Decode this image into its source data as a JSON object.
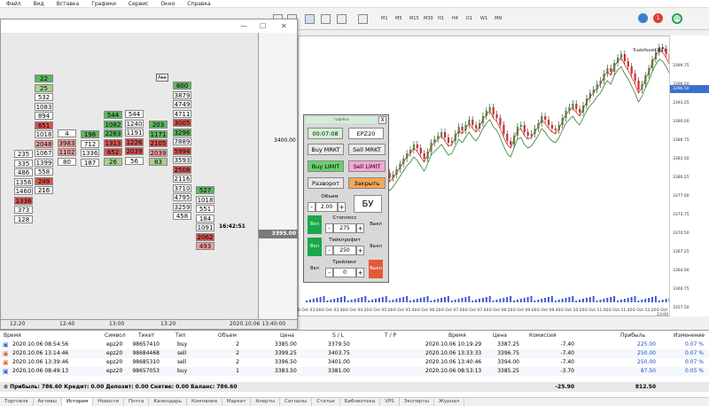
{
  "title_fragment": "Файл · Вид · Вставка",
  "menu": [
    "Файл",
    "Вид",
    "Вставка",
    "Графики",
    "Сервис",
    "Окно",
    "Справка"
  ],
  "timeframes": [
    "M1",
    "M5",
    "M15",
    "M30",
    "H1",
    "H4",
    "D1",
    "W1",
    "MN"
  ],
  "notifications": {
    "count": "1",
    "ping": "LTE"
  },
  "cluster_window": {
    "price_label": "3400.00",
    "last_price": "3395.00",
    "last_time": "16:42:51",
    "time_ticks": [
      "12:20",
      "12:40",
      "13:00",
      "13:20",
      "2020.10.06 13:40:00"
    ],
    "columns": [
      {
        "cells": [
          [
            "22",
            "#5cb85c"
          ],
          [
            "25",
            "#a8d08d"
          ],
          [
            "532",
            "#fff"
          ],
          [
            "1083",
            "#fff"
          ],
          [
            "894",
            "#fff"
          ],
          [
            "651",
            "#d9534f"
          ],
          [
            "1018",
            "#fff"
          ],
          [
            "2048",
            "#f0a0a0"
          ],
          [
            "1067",
            "#fff"
          ],
          [
            "1399",
            "#fff"
          ],
          [
            "558",
            "#fff"
          ],
          [
            "249",
            "#d9534f"
          ],
          [
            "216",
            "#f5f5f5"
          ]
        ]
      },
      {
        "cells": [
          [
            "235",
            "#fff"
          ],
          [
            "335",
            "#fff"
          ],
          [
            "486",
            "#fff"
          ],
          [
            "1356",
            "#fff"
          ],
          [
            "1460",
            "#fff"
          ],
          [
            "1336",
            "#d9534f"
          ],
          [
            "373",
            "#fff"
          ],
          [
            "128",
            "#fff"
          ]
        ]
      },
      {
        "cells": [
          [
            "4",
            "#fff"
          ],
          [
            "3983",
            "#f0a0a0"
          ],
          [
            "1102",
            "#f0a0a0"
          ],
          [
            "80",
            "#fff"
          ]
        ]
      },
      {
        "cells": [
          [
            "196",
            "#5cb85c"
          ],
          [
            "712",
            "#fff"
          ],
          [
            "1336",
            "#fff"
          ],
          [
            "187",
            "#fff"
          ]
        ]
      },
      {
        "cells": [
          [
            "544",
            "#5cb85c"
          ],
          [
            "1082",
            "#5cb85c"
          ],
          [
            "2283",
            "#5cb85c"
          ],
          [
            "1313",
            "#d9534f"
          ],
          [
            "652",
            "#d9534f"
          ],
          [
            "26",
            "#a8d08d"
          ]
        ]
      },
      {
        "cells": [
          [
            "544",
            "#fff"
          ],
          [
            "1240",
            "#fff"
          ],
          [
            "1191",
            "#fff"
          ],
          [
            "1226",
            "#d9534f"
          ],
          [
            "2039",
            "#d9534f"
          ],
          [
            "56",
            "#fff"
          ]
        ]
      },
      {
        "cells": [
          [
            "203",
            "#5cb85c"
          ],
          [
            "1171",
            "#5cb85c"
          ],
          [
            "2105",
            "#d9534f"
          ],
          [
            "2039",
            "#f0a0a0"
          ],
          [
            "83",
            "#a8d08d"
          ]
        ]
      },
      {
        "cells": [
          [
            "800",
            "#5cb85c"
          ],
          [
            "3879",
            "#fff"
          ],
          [
            "4749",
            "#fff"
          ],
          [
            "4711",
            "#fff"
          ],
          [
            "3005",
            "#d9534f"
          ],
          [
            "3296",
            "#5cb85c"
          ],
          [
            "7889",
            "#fff"
          ],
          [
            "5994",
            "#d9534f"
          ],
          [
            "3593",
            "#fff"
          ],
          [
            "2508",
            "#d9534f"
          ],
          [
            "2116",
            "#fff"
          ],
          [
            "3710",
            "#fff"
          ],
          [
            "4795",
            "#fff"
          ],
          [
            "3259",
            "#fff"
          ],
          [
            "458",
            "#fff"
          ]
        ]
      },
      {
        "cells": [
          [
            "527",
            "#5cb85c"
          ],
          [
            "1018",
            "#fff"
          ],
          [
            "551",
            "#fff"
          ],
          [
            "184",
            "#fff"
          ],
          [
            "1091",
            "#fff"
          ],
          [
            "2062",
            "#d9534f"
          ],
          [
            "493",
            "#f0a0a0"
          ]
        ]
      }
    ]
  },
  "chart": {
    "label": "TradePanelCME3",
    "price_ticks": [
      "3399.75",
      "3396.50",
      "3393.25",
      "3390.00",
      "3386.75",
      "3383.50",
      "3380.25",
      "3377.00",
      "3373.75",
      "3370.50",
      "3367.25",
      "3364.00",
      "3360.75",
      "3357.50"
    ],
    "current_price": "3396.50",
    "time_ticks": [
      "6 Oct 03:00",
      "6 Oct 03:40",
      "6 Oct 04:20",
      "6 Oct 05:00",
      "6 Oct 05:40",
      "6 Oct 06:20",
      "6 Oct 07:00",
      "6 Oct 07:40",
      "6 Oct 08:20",
      "6 Oct 09:00",
      "6 Oct 09:40",
      "6 Oct 10:20",
      "6 Oct 11:00",
      "6 Oct 11:40",
      "6 Oct 12:20",
      "6 Oct 13:00"
    ]
  },
  "trade_panel": {
    "title": "тофяка",
    "time": "00:07:08",
    "symbol": "EPZ20",
    "buy_market": "Buy MRKT",
    "sell_market": "Sell MRKT",
    "buy_limit": "Buy LIMIT",
    "sell_limit": "Sell LIMIT",
    "reverse": "Разворот",
    "close": "Закрыть",
    "volume_label": "Объем",
    "volume": "2.00",
    "be": "БУ",
    "sl_label": "Стоплосс",
    "sl_value": "275",
    "tp_label": "Тейкпрофит",
    "tp_value": "250",
    "trail_label": "Трейлинг",
    "trail_value": "0",
    "on": "Вкл",
    "off": "Выкл",
    "minus": "-",
    "plus": "+",
    "close_x": "X"
  },
  "terminal": {
    "headers": [
      "Время",
      "Символ",
      "Тикет",
      "Тип",
      "Объем",
      "Цена",
      "S / L",
      "T / P",
      "Время",
      "Цена",
      "Комиссия",
      "Прибыль",
      "Изменение"
    ],
    "rows": [
      [
        "2020.10.06 08:54:56",
        "epz20",
        "98657410",
        "buy",
        "2",
        "3385.00",
        "3379.50",
        "",
        "2020.10.06 10:19:29",
        "3387.25",
        "-7.40",
        "225.00",
        "0.07 %"
      ],
      [
        "2020.10.06 13:14:46",
        "epz20",
        "98684468",
        "sell",
        "2",
        "3399.25",
        "3403.75",
        "",
        "2020.10.06 13:33:33",
        "3396.75",
        "-7.40",
        "250.00",
        "0.07 %"
      ],
      [
        "2020.10.06 13:39:46",
        "epz20",
        "98685310",
        "sell",
        "2",
        "3396.50",
        "3401.00",
        "",
        "2020.10.06 13:40:46",
        "3394.00",
        "-7.40",
        "250.00",
        "0.07 %"
      ],
      [
        "2020.10.06 08:49:13",
        "epz20",
        "98657053",
        "buy",
        "1",
        "3383.50",
        "3381.00",
        "",
        "2020.10.06 08:53:13",
        "3385.25",
        "-3.70",
        "87.50",
        "0.05 %"
      ]
    ],
    "balance": "⊙ Прибыль: 786.60  Кредит: 0.00  Депозит: 0.00  Снятие: 0.00  Баланс: 786.60",
    "total_commission": "-25.90",
    "total_profit": "812.50",
    "tabs": [
      "Торговля",
      "Активы",
      "История",
      "Новости",
      "Почта",
      "Календарь",
      "Компания",
      "Маркет",
      "Алерты",
      "Сигналы",
      "Статьи",
      "Библиотека",
      "VPS",
      "Эксперты",
      "Журнал"
    ],
    "active_tab": "История"
  }
}
